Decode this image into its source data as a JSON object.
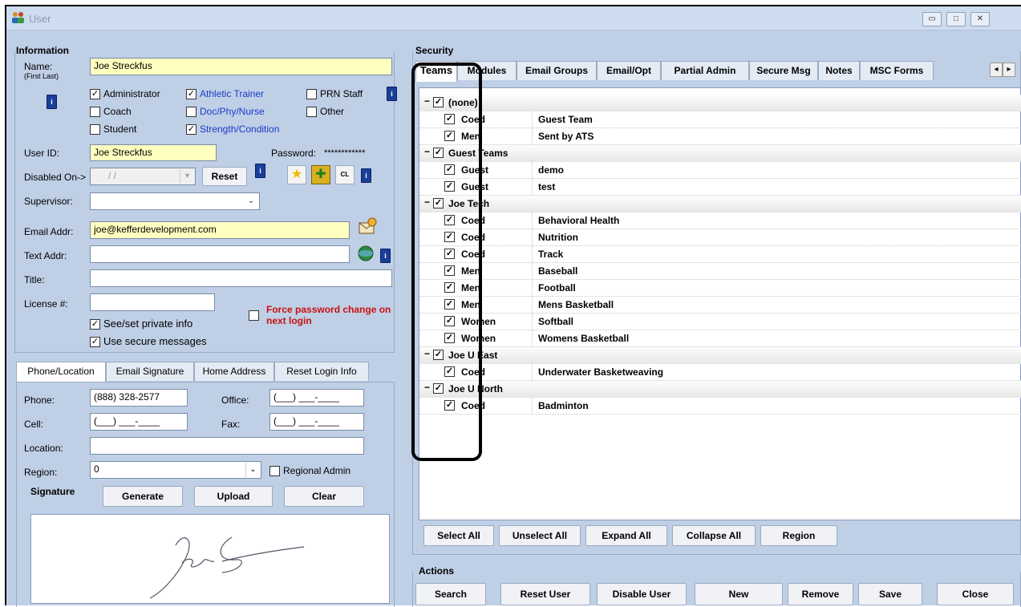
{
  "window": {
    "title": "User",
    "minimize_glyph": "▭",
    "maximize_glyph": "□",
    "close_glyph": "✕"
  },
  "information": {
    "section_title": "Information",
    "name_label": "Name:",
    "name_hint": "(First Last)",
    "name_value": "Joe Streckfus",
    "roles": {
      "administrator": {
        "label": "Administrator",
        "checked": true
      },
      "athletic_trainer": {
        "label": "Athletic Trainer",
        "checked": true
      },
      "prn_staff": {
        "label": "PRN Staff",
        "checked": false
      },
      "coach": {
        "label": "Coach",
        "checked": false
      },
      "doc_phy_nurse": {
        "label": "Doc/Phy/Nurse",
        "checked": false
      },
      "other": {
        "label": "Other",
        "checked": false
      },
      "student": {
        "label": "Student",
        "checked": false
      },
      "strength_condition": {
        "label": "Strength/Condition",
        "checked": true
      }
    },
    "user_id_label": "User ID:",
    "user_id_value": "Joe Streckfus",
    "password_label": "Password:",
    "password_value": "************",
    "disabled_on_label": "Disabled On->",
    "disabled_on_value": "/  /",
    "reset_label": "Reset",
    "cl_label": "CL",
    "supervisor_label": "Supervisor:",
    "supervisor_value": "",
    "email_label": "Email Addr:",
    "email_value": "joe@kefferdevelopment.com",
    "text_label": "Text Addr:",
    "text_value": "",
    "title_label": "Title:",
    "title_value": "",
    "license_label": "License #:",
    "license_value": "",
    "see_private_label": "See/set private info",
    "secure_messages_label": "Use secure messages",
    "force_password_label": "Force password change on next login"
  },
  "lower_tabs": [
    "Phone/Location",
    "Email Signature",
    "Home Address",
    "Reset Login Info"
  ],
  "phone": {
    "phone_label": "Phone:",
    "phone_value": "(888) 328-2577",
    "office_label": "Office:",
    "office_value": "(___) ___-____",
    "cell_label": "Cell:",
    "cell_value": "(___) ___-____",
    "fax_label": "Fax:",
    "fax_value": "(___) ___-____",
    "location_label": "Location:",
    "location_value": "",
    "region_label": "Region:",
    "region_value": "0",
    "regional_admin_label": "Regional Admin"
  },
  "signature": {
    "title": "Signature",
    "generate_label": "Generate",
    "upload_label": "Upload",
    "clear_label": "Clear"
  },
  "security": {
    "section_title": "Security",
    "tabs": [
      "Teams",
      "Modules",
      "Email Groups",
      "Email/Opt",
      "Partial Admin",
      "Secure Msg",
      "Notes",
      "MSC Forms"
    ],
    "scroll_left": "◂",
    "scroll_right": "▸",
    "groups": [
      {
        "name": "(none)",
        "rows": [
          [
            "Coed",
            "Guest Team"
          ],
          [
            "Men",
            "Sent by ATS"
          ]
        ]
      },
      {
        "name": "Guest Teams",
        "rows": [
          [
            "Guest",
            "demo"
          ],
          [
            "Guest",
            "test"
          ]
        ]
      },
      {
        "name": "Joe Tech",
        "rows": [
          [
            "Coed",
            "Behavioral Health"
          ],
          [
            "Coed",
            "Nutrition"
          ],
          [
            "Coed",
            "Track"
          ],
          [
            "Men",
            "Baseball"
          ],
          [
            "Men",
            "Football"
          ],
          [
            "Men",
            "Mens Basketball"
          ],
          [
            "Women",
            "Softball"
          ],
          [
            "Women",
            "Womens Basketball"
          ]
        ]
      },
      {
        "name": "Joe U East",
        "rows": [
          [
            "Coed",
            "Underwater Basketweaving"
          ]
        ]
      },
      {
        "name": "Joe U North",
        "rows": [
          [
            "Coed",
            "Badminton"
          ]
        ]
      }
    ],
    "buttons": [
      "Select All",
      "Unselect All",
      "Expand All",
      "Collapse All",
      "Region"
    ]
  },
  "actions": {
    "section_title": "Actions",
    "buttons": [
      "Search",
      "Reset User",
      "Disable User",
      "New",
      "Remove",
      "Save",
      "Close"
    ]
  },
  "icons": {
    "book": "book-icon",
    "star": "★",
    "plus": "✚",
    "check": "✓"
  }
}
